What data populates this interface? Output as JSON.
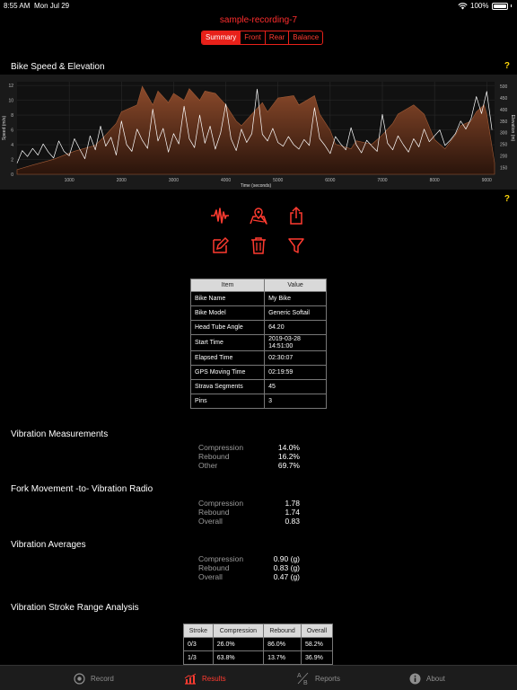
{
  "status": {
    "time": "8:55 AM",
    "date": "Mon Jul 29",
    "battery": "100%"
  },
  "title": "sample-recording-7",
  "segments": [
    "Summary",
    "Front",
    "Rear",
    "Balance"
  ],
  "chart_section": {
    "title": "Bike Speed & Elevation",
    "help": "?"
  },
  "chart_data": {
    "type": "area",
    "xlabel": "Time (seconds)",
    "ylabel": "Speed (m/s)",
    "y2label": "Elevation (m)",
    "x_ticks": [
      "1000",
      "2000",
      "3000",
      "4000",
      "5000",
      "6000",
      "7000",
      "8000",
      "9000"
    ],
    "y_ticks": [
      "0",
      "2",
      "4",
      "6",
      "8",
      "10",
      "12"
    ],
    "y2_ticks": [
      "150",
      "200",
      "250",
      "300",
      "350",
      "400",
      "450",
      "500"
    ],
    "xlim": [
      0,
      9150
    ],
    "ylim": [
      0,
      12.5
    ],
    "y2lim": [
      120,
      520
    ],
    "series": [
      {
        "x": [
          0,
          300,
          700,
          1100,
          1500,
          1700,
          1900,
          2000,
          2300,
          2400,
          2600,
          2700,
          2900,
          3000,
          3200,
          3300,
          3500,
          3600,
          3800,
          4000,
          4200,
          4300,
          4500,
          4700,
          4800,
          5000,
          5300,
          5400,
          5700,
          5800,
          6000,
          6100,
          6400,
          6500,
          6800,
          7000,
          7200,
          7300,
          7600,
          7800,
          8000,
          8200,
          8400,
          8500,
          8700,
          8800,
          8950,
          9000,
          9150
        ],
        "y": [
          140,
          160,
          185,
          220,
          245,
          290,
          340,
          390,
          420,
          500,
          420,
          480,
          430,
          470,
          440,
          490,
          440,
          480,
          470,
          420,
          350,
          330,
          380,
          430,
          390,
          450,
          460,
          420,
          460,
          380,
          310,
          250,
          230,
          265,
          250,
          290,
          340,
          380,
          420,
          380,
          270,
          230,
          290,
          330,
          350,
          390,
          420,
          380,
          170
        ]
      },
      {
        "x": [
          0,
          100,
          200,
          300,
          400,
          500,
          600,
          700,
          800,
          900,
          1000,
          1100,
          1200,
          1300,
          1400,
          1500,
          1600,
          1700,
          1800,
          1900,
          2000,
          2100,
          2200,
          2300,
          2400,
          2500,
          2600,
          2700,
          2800,
          2900,
          3000,
          3100,
          3200,
          3300,
          3400,
          3500,
          3600,
          3700,
          3800,
          3900,
          4000,
          4100,
          4200,
          4300,
          4400,
          4500,
          4600,
          4700,
          4800,
          4900,
          5000,
          5100,
          5200,
          5300,
          5400,
          5500,
          5600,
          5700,
          5800,
          5900,
          6000,
          6100,
          6200,
          6300,
          6400,
          6500,
          6600,
          6700,
          6800,
          6900,
          7000,
          7100,
          7200,
          7300,
          7400,
          7500,
          7600,
          7700,
          7800,
          7900,
          8000,
          8100,
          8200,
          8300,
          8400,
          8500,
          8600,
          8700,
          8800,
          8900,
          9000,
          9100
        ],
        "y": [
          1.5,
          3.2,
          2.4,
          3.5,
          2.6,
          4.1,
          3.0,
          2.2,
          4.5,
          3.1,
          2.5,
          4.8,
          3.4,
          2.1,
          5.2,
          3.3,
          6.5,
          3.8,
          5.0,
          2.6,
          7.2,
          4.0,
          3.1,
          6.1,
          4.6,
          3.5,
          8.8,
          4.5,
          6.2,
          3.0,
          5.5,
          4.1,
          9.2,
          4.8,
          3.6,
          8.0,
          4.2,
          6.5,
          3.4,
          5.6,
          9.5,
          4.8,
          3.2,
          6.1,
          4.3,
          5.5,
          11.5,
          5.4,
          4.5,
          6.2,
          4.3,
          3.8,
          5.1,
          4.0,
          3.4,
          4.7,
          3.9,
          9.0,
          4.8,
          3.9,
          2.8,
          5.1,
          4.1,
          3.3,
          6.3,
          4.0,
          2.9,
          4.6,
          3.8,
          3.1,
          8.1,
          4.2,
          3.3,
          5.2,
          4.0,
          3.0,
          4.8,
          3.7,
          6.1,
          4.4,
          5.2,
          6.0,
          3.9,
          4.6,
          5.5,
          7.2,
          6.1,
          7.5,
          10.5,
          8.2,
          11.2,
          6.0
        ]
      }
    ]
  },
  "help2": "?",
  "info_table": {
    "headers": [
      "Item",
      "Value"
    ],
    "rows": [
      [
        "Bike Name",
        "My Bike"
      ],
      [
        "Bike Model",
        "Generic Softail"
      ],
      [
        "Head Tube Angle",
        "64.20"
      ],
      [
        "Start Time",
        "2019-03-28",
        "14:51:00"
      ],
      [
        "Elapsed Time",
        "02:30:07"
      ],
      [
        "GPS Moving Time",
        "02:19:59"
      ],
      [
        "Strava Segments",
        "45"
      ],
      [
        "Pins",
        "3"
      ]
    ]
  },
  "vibration_measurements": {
    "title": "Vibration Measurements",
    "rows": [
      [
        "Compression",
        "14.0%"
      ],
      [
        "Rebound",
        "16.2%"
      ],
      [
        "Other",
        "69.7%"
      ]
    ]
  },
  "fork_movement": {
    "title": "Fork Movement -to- Vibration Radio",
    "rows": [
      [
        "Compression",
        "1.78"
      ],
      [
        "Rebound",
        "1.74"
      ],
      [
        "Overall",
        "0.83"
      ]
    ]
  },
  "vibration_averages": {
    "title": "Vibration Averages",
    "rows": [
      [
        "Compression",
        "0.90 (g)"
      ],
      [
        "Rebound",
        "0.83 (g)"
      ],
      [
        "Overall",
        "0.47 (g)"
      ]
    ]
  },
  "stroke_range": {
    "title": "Vibration Stroke Range Analysis",
    "headers": [
      "Stroke",
      "Compression",
      "Rebound",
      "Overall"
    ],
    "rows": [
      [
        "0/3",
        "26.0%",
        "86.0%",
        "58.2%"
      ],
      [
        "1/3",
        "63.8%",
        "13.7%",
        "36.9%"
      ]
    ]
  },
  "tabs": [
    "Record",
    "Results",
    "Reports",
    "About"
  ],
  "tab_icons": {
    "reports": [
      "A",
      "B"
    ]
  },
  "colors": {
    "accent": "#ff3b30",
    "elevation": "#8b4a2b",
    "help": "#ffd60a"
  }
}
